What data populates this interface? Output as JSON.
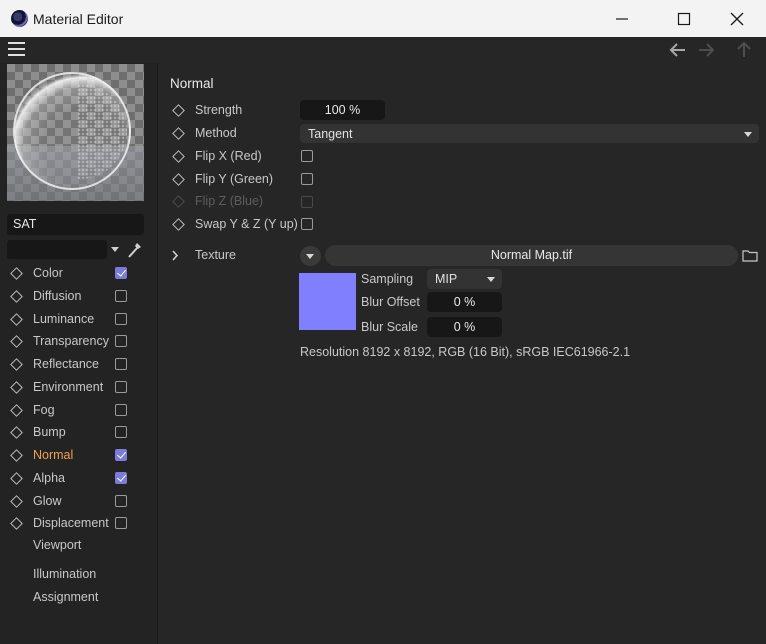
{
  "window": {
    "title": "Material Editor",
    "controls": [
      "minimize-icon",
      "maximize-icon",
      "close-icon"
    ]
  },
  "toolbar": {
    "menu_icon": "hamburger-menu-icon",
    "nav_icons": [
      "arrow-back-icon",
      "arrow-forward-icon",
      "arrow-up-icon"
    ]
  },
  "material": {
    "name": "SAT",
    "filter_value": ""
  },
  "channels": [
    {
      "label": "Color",
      "checked": true,
      "active": false
    },
    {
      "label": "Diffusion",
      "checked": false,
      "active": false
    },
    {
      "label": "Luminance",
      "checked": false,
      "active": false
    },
    {
      "label": "Transparency",
      "checked": false,
      "active": false
    },
    {
      "label": "Reflectance",
      "checked": false,
      "active": false
    },
    {
      "label": "Environment",
      "checked": false,
      "active": false
    },
    {
      "label": "Fog",
      "checked": false,
      "active": false
    },
    {
      "label": "Bump",
      "checked": false,
      "active": false
    },
    {
      "label": "Normal",
      "checked": true,
      "active": true
    },
    {
      "label": "Alpha",
      "checked": true,
      "active": false
    },
    {
      "label": "Glow",
      "checked": false,
      "active": false
    },
    {
      "label": "Displacement",
      "checked": false,
      "active": false
    }
  ],
  "extra_items": [
    "Viewport",
    "Illumination",
    "Assignment"
  ],
  "normal": {
    "section_title": "Normal",
    "strength_label": "Strength",
    "strength_value": "100 %",
    "method_label": "Method",
    "method_value": "Tangent",
    "flip_x_label": "Flip X (Red)",
    "flip_x_checked": false,
    "flip_y_label": "Flip Y (Green)",
    "flip_y_checked": false,
    "flip_z_label": "Flip Z (Blue)",
    "flip_z_checked": false,
    "swap_label": "Swap Y & Z (Y up)",
    "swap_checked": false
  },
  "texture": {
    "label": "Texture",
    "file_name": "Normal Map.tif",
    "swatch_color": "#8080ff",
    "sampling_label": "Sampling",
    "sampling_value": "MIP",
    "blur_offset_label": "Blur Offset",
    "blur_offset_value": "0 %",
    "blur_scale_label": "Blur Scale",
    "blur_scale_value": "0 %",
    "resolution_info": "Resolution 8192 x 8192, RGB (16 Bit), sRGB IEC61966-2.1"
  },
  "colors": {
    "accent_active": "#f0a050",
    "checkbox_on": "#7c7cd8",
    "panel_bg": "#262626"
  }
}
